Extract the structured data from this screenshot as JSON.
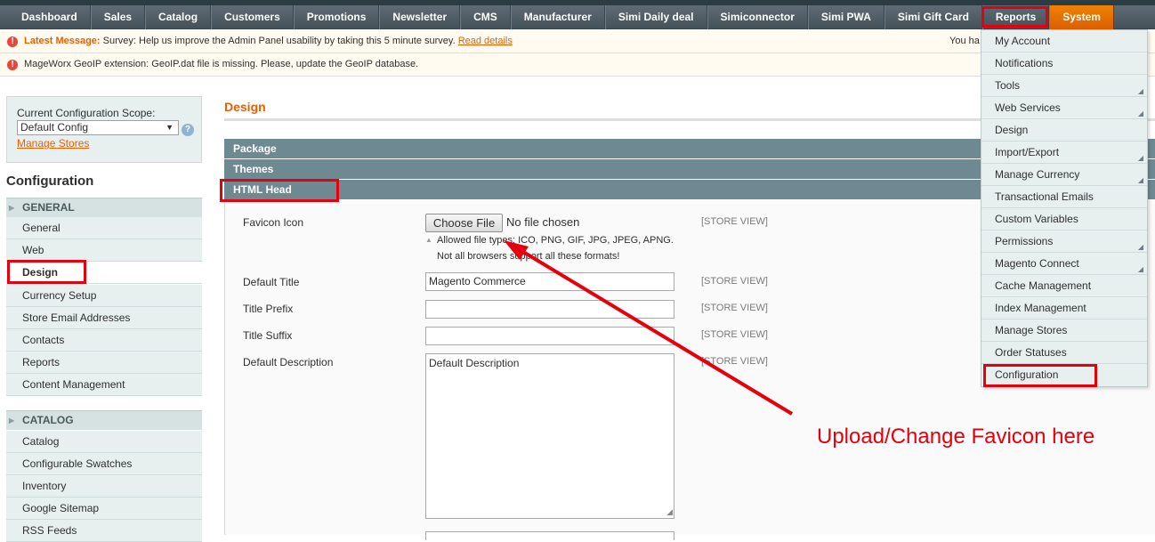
{
  "nav": {
    "items": [
      "Dashboard",
      "Sales",
      "Catalog",
      "Customers",
      "Promotions",
      "Newsletter",
      "CMS",
      "Manufacturer",
      "Simi Daily deal",
      "Simiconnector",
      "Simi PWA",
      "Simi Gift Card",
      "Reports",
      "System"
    ],
    "active": "System"
  },
  "messages": {
    "latest_label": "Latest Message:",
    "latest_text": "Survey: Help us improve the Admin Panel usability by taking this 5 minute survey.",
    "latest_link": "Read details",
    "right_text": "You ha",
    "geoip_text": "MageWorx GeoIP extension: GeoIP.dat file is missing. Please, update the GeoIP database."
  },
  "scope": {
    "label": "Current Configuration Scope:",
    "selected": "Default Config",
    "manage_link": "Manage Stores",
    "help": "?"
  },
  "sidebar": {
    "title": "Configuration",
    "general_header": "GENERAL",
    "general_items": [
      "General",
      "Web",
      "Design",
      "Currency Setup",
      "Store Email Addresses",
      "Contacts",
      "Reports",
      "Content Management"
    ],
    "catalog_header": "CATALOG",
    "catalog_items": [
      "Catalog",
      "Configurable Swatches",
      "Inventory",
      "Google Sitemap",
      "RSS Feeds"
    ]
  },
  "main": {
    "title": "Design",
    "sections": [
      "Package",
      "Themes",
      "HTML Head"
    ],
    "fields": {
      "favicon_label": "Favicon Icon",
      "choose_file": "Choose File",
      "no_file": "No file chosen",
      "note_line1": "Allowed file types: ICO, PNG, GIF, JPG, JPEG, APNG.",
      "note_line2": "Not all browsers support all these formats!",
      "default_title_label": "Default Title",
      "default_title_value": "Magento Commerce",
      "title_prefix_label": "Title Prefix",
      "title_suffix_label": "Title Suffix",
      "default_description_label": "Default Description",
      "default_description_value": "Default Description",
      "scope_tag": "[STORE VIEW]"
    }
  },
  "system_menu": {
    "items": [
      {
        "label": "My Account",
        "sub": false
      },
      {
        "label": "Notifications",
        "sub": false
      },
      {
        "label": "Tools",
        "sub": true
      },
      {
        "label": "Web Services",
        "sub": true
      },
      {
        "label": "Design",
        "sub": false
      },
      {
        "label": "Import/Export",
        "sub": true
      },
      {
        "label": "Manage Currency",
        "sub": true
      },
      {
        "label": "Transactional Emails",
        "sub": false
      },
      {
        "label": "Custom Variables",
        "sub": false
      },
      {
        "label": "Permissions",
        "sub": true
      },
      {
        "label": "Magento Connect",
        "sub": true
      },
      {
        "label": "Cache Management",
        "sub": false
      },
      {
        "label": "Index Management",
        "sub": false
      },
      {
        "label": "Manage Stores",
        "sub": false
      },
      {
        "label": "Order Statuses",
        "sub": false
      },
      {
        "label": "Configuration",
        "sub": false
      }
    ]
  },
  "annotation": {
    "text": "Upload/Change Favicon here",
    "color": "#e6000d"
  },
  "colors": {
    "accent": "#eb5e00",
    "nav_bg": "#4f5d65",
    "section_bg": "#6f8992",
    "sidebar_bg": "#e7efef"
  }
}
